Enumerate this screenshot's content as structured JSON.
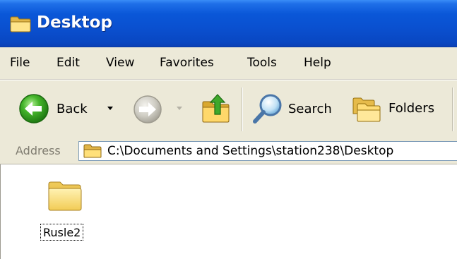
{
  "window": {
    "title": "Desktop",
    "title_icon": "folder-icon"
  },
  "menu": {
    "items": [
      "File",
      "Edit",
      "View",
      "Favorites",
      "Tools",
      "Help"
    ]
  },
  "toolbar": {
    "back_label": "Back",
    "search_label": "Search",
    "folders_label": "Folders",
    "icons": {
      "back": "back-arrow-icon",
      "forward": "forward-arrow-icon",
      "up": "folder-up-icon",
      "search": "magnifier-icon",
      "folders": "folders-icon"
    }
  },
  "address": {
    "label": "Address",
    "value": "C:\\Documents and Settings\\station238\\Desktop"
  },
  "content": {
    "items": [
      {
        "label": "Rusle2",
        "icon": "folder-icon"
      }
    ]
  },
  "colors": {
    "title_bar": "#0a57d8",
    "chrome": "#ece9d8",
    "back_button": "#3fae2a",
    "folder": "#f5d76e"
  }
}
